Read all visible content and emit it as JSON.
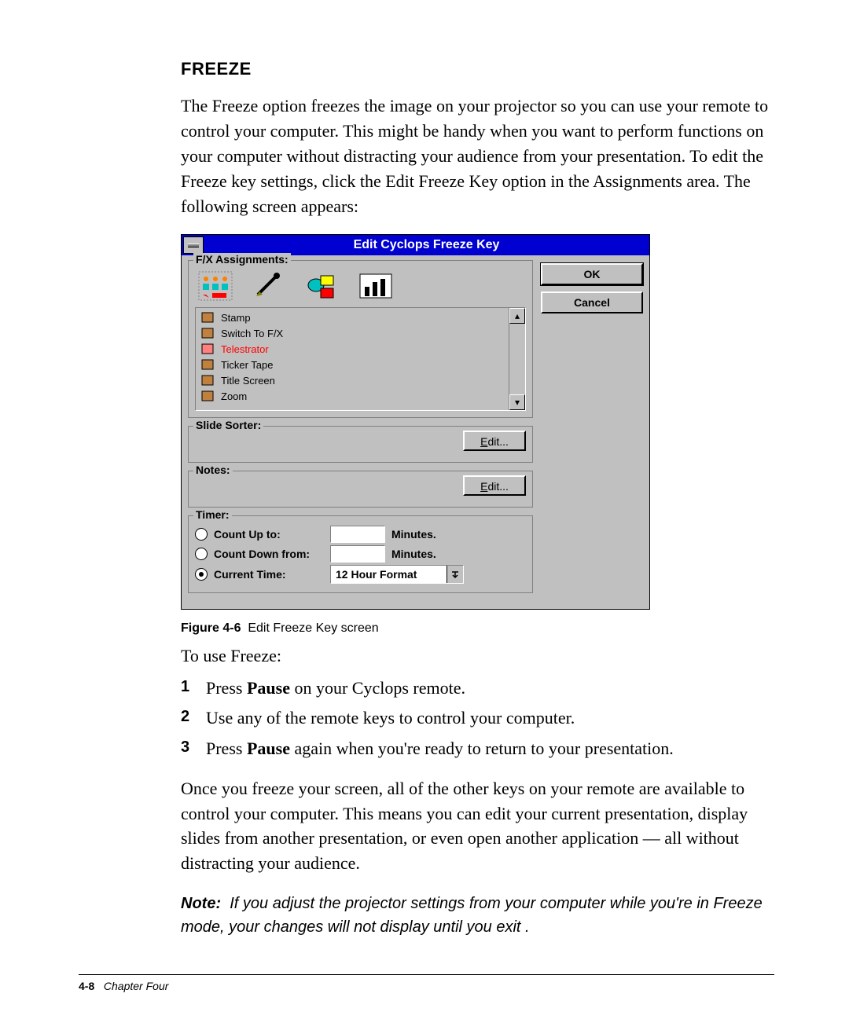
{
  "heading": "FREEZE",
  "intro": "The Freeze option freezes the image on your projector so you can use your remote to control your computer. This might be handy when you want to perform functions on your computer without distracting your audience from your presentation. To edit the Freeze key settings, click the Edit Freeze Key option in the Assignments area. The following screen appears:",
  "dialog": {
    "title": "Edit Cyclops Freeze Key",
    "fx_group": "F/X Assignments:",
    "fx_icons": [
      "toolbar-icon",
      "laser-icon",
      "shapes-icon",
      "chart-icon"
    ],
    "list": [
      {
        "icon": "stamp-icon",
        "label": "Stamp",
        "selected": false
      },
      {
        "icon": "switch-icon",
        "label": "Switch To F/X",
        "selected": false
      },
      {
        "icon": "telestrator-icon",
        "label": "Telestrator",
        "selected": true
      },
      {
        "icon": "ticker-icon",
        "label": "Ticker Tape",
        "selected": false
      },
      {
        "icon": "title-icon",
        "label": "Title Screen",
        "selected": false
      },
      {
        "icon": "zoom-icon",
        "label": "Zoom",
        "selected": false
      }
    ],
    "slide_sorter": {
      "title": "Slide Sorter:",
      "button": "Edit..."
    },
    "notes": {
      "title": "Notes:",
      "button": "Edit..."
    },
    "timer": {
      "title": "Timer:",
      "count_up": "Count Up to:",
      "count_down": "Count Down from:",
      "current": "Current Time:",
      "minutes": "Minutes.",
      "format": "12 Hour Format"
    },
    "ok": "OK",
    "cancel": "Cancel"
  },
  "figure": {
    "label": "Figure 4-6",
    "text": "Edit Freeze Key screen"
  },
  "to_use": "To use Freeze:",
  "steps": [
    {
      "n": "1",
      "pre": "Press ",
      "bold": "Pause",
      "post": " on your Cyclops remote."
    },
    {
      "n": "2",
      "pre": "Use any of the remote keys to control your computer.",
      "bold": "",
      "post": ""
    },
    {
      "n": "3",
      "pre": "Press ",
      "bold": "Pause",
      "post": " again when you're ready to return to your presentation."
    }
  ],
  "after": "Once you freeze your screen, all of the other keys on your remote are available to control your computer. This means you can edit your current presentation, display slides from another presentation, or even open another application — all without distracting your audience.",
  "note": {
    "label": "Note:",
    "text": "If you adjust the projector settings from your computer while you're in Freeze mode, your changes will not display until you exit ."
  },
  "footer": {
    "page": "4-8",
    "chapter": "Chapter Four"
  }
}
